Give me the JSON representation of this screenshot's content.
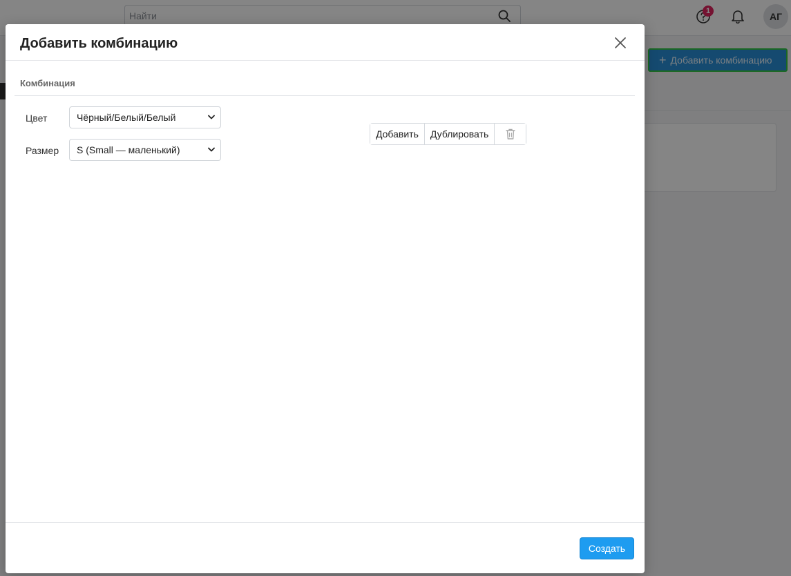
{
  "topbar": {
    "search_placeholder": "Найти",
    "help_badge_count": "1",
    "avatar_initials": "АГ"
  },
  "page": {
    "add_combination_label": "Добавить комбинацию"
  },
  "modal": {
    "title": "Добавить комбинацию",
    "section_title": "Комбинация",
    "fields": [
      {
        "label": "Цвет",
        "value": "Чёрный/Белый/Белый"
      },
      {
        "label": "Размер",
        "value": "S (Small — маленький)"
      }
    ],
    "actions": {
      "add_label": "Добавить",
      "duplicate_label": "Дублировать"
    },
    "footer": {
      "create_label": "Создать"
    }
  },
  "colors": {
    "primary": "#1e9cf0",
    "badge": "#e0245e",
    "highlight_border": "#33c544"
  },
  "icons": [
    "search-icon",
    "help-icon",
    "bell-icon",
    "plus-icon",
    "close-icon",
    "chevron-down-icon",
    "trash-icon"
  ]
}
